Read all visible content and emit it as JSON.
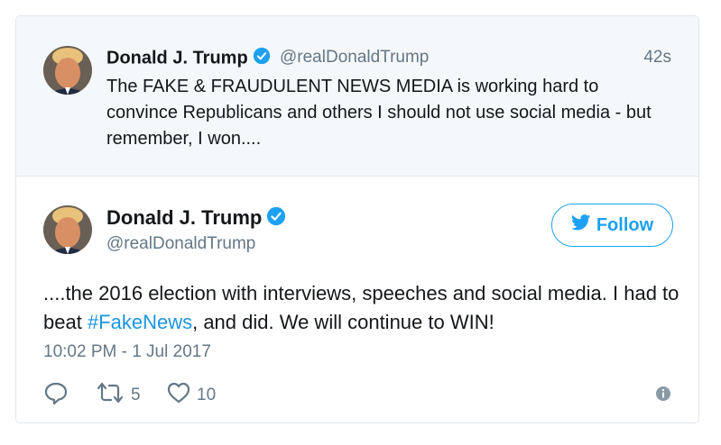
{
  "quoted": {
    "name": "Donald J. Trump",
    "handle": "@realDonaldTrump",
    "time": "42s",
    "text": "The FAKE & FRAUDULENT NEWS MEDIA is working hard to convince Republicans and others I should not use social media - but remember, I won...."
  },
  "main": {
    "name": "Donald J. Trump",
    "handle": "@realDonaldTrump",
    "follow_label": "Follow",
    "text_before": "....the 2016 election with interviews, speeches and social media. I had to beat ",
    "hashtag": "#FakeNews",
    "text_after": ", and did. We will continue to WIN!",
    "timestamp": "10:02 PM - 1 Jul 2017"
  },
  "actions": {
    "retweet_count": "5",
    "like_count": "10"
  },
  "colors": {
    "accent": "#1da1f2",
    "verified": "#1da1f2",
    "muted": "#657786",
    "quoted_bg": "#f5f8fa"
  },
  "icons": {
    "verified": "verified-badge-icon",
    "follow": "twitter-bird-icon",
    "reply": "reply-icon",
    "retweet": "retweet-icon",
    "like": "heart-icon",
    "info": "info-icon"
  }
}
